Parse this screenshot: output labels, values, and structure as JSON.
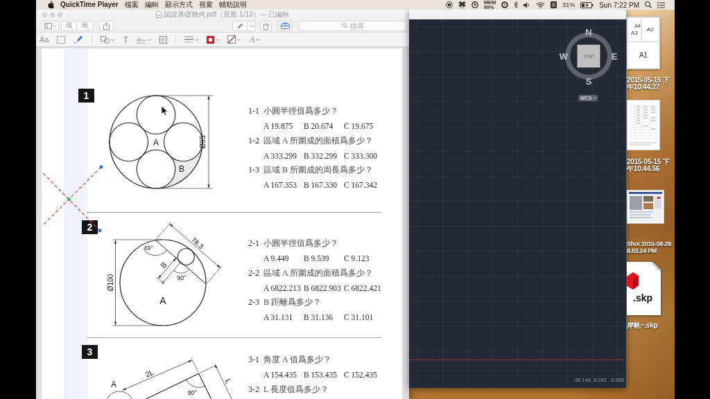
{
  "menu_bar": {
    "app_name": "QuickTime Player",
    "menus": [
      "檔案",
      "編輯",
      "顯示方式",
      "視窗",
      "輔助說明"
    ],
    "memory_label": "MEM",
    "memory_value": "99%",
    "battery_percent": "31%",
    "battery_charging": true,
    "clock": "Sun 7:22 PM"
  },
  "pdf_window": {
    "title": "認證基礎幾何.pdf（頁面 1/13）— 已編輯",
    "toolbar_left": [
      {
        "kind": "sidebar",
        "has_menu": true
      },
      {
        "kind": "zoom-out"
      },
      {
        "kind": "zoom-in"
      },
      {
        "kind": "share"
      }
    ],
    "toolbar_right": [
      {
        "kind": "highlight",
        "has_menu": true
      },
      {
        "kind": "rotate"
      },
      {
        "kind": "toolbox",
        "on": true
      }
    ],
    "search_placeholder": "搜尋",
    "markup_tool_groups": [
      [
        {
          "kind": "text-style",
          "label": "Aa",
          "selected": false
        },
        {
          "kind": "rect-select",
          "selected": false
        },
        {
          "kind": "sketch",
          "selected": true
        }
      ],
      [
        {
          "kind": "shapes",
          "has_menu": true,
          "selected": false
        },
        {
          "kind": "text",
          "label": "T",
          "selected": false
        },
        {
          "kind": "sign",
          "has_menu": true,
          "selected": false
        },
        {
          "kind": "note",
          "selected": false
        }
      ],
      [
        {
          "kind": "line-style",
          "has_menu": true,
          "selected": false
        },
        {
          "kind": "border-color",
          "color": "#b3262d",
          "has_menu": true,
          "selected": false
        },
        {
          "kind": "fill-color",
          "has_menu": true,
          "selected": false
        },
        {
          "kind": "font",
          "label": "A",
          "has_menu": true,
          "selected": false
        }
      ]
    ],
    "page": {
      "annotation": {
        "kind": "dashed-cross",
        "selected": true
      },
      "problems": [
        {
          "number": "1",
          "diagram": {
            "kind": "circles-in-circle",
            "labels": [
              "A",
              "B",
              "Ø95"
            ]
          },
          "questions": [
            {
              "number": "1-1",
              "text": "小圓半徑值爲多少？",
              "options": [
                "A 19.875",
                "B 20.674",
                "C 19.675"
              ]
            },
            {
              "number": "1-2",
              "text": "區域 A 所圍成的面積爲多少？",
              "options": [
                "A 333.299",
                "B 332.299",
                "C 333.300"
              ]
            },
            {
              "number": "1-3",
              "text": "區域 B 所圍成的周長爲多少？",
              "options": [
                "A 167.353",
                "B 167.330",
                "C 167.342"
              ]
            }
          ]
        },
        {
          "number": "2",
          "diagram": {
            "kind": "circle-with-chord",
            "labels": [
              "78.3",
              "49°",
              "B",
              "90°",
              "Ø100",
              "A"
            ]
          },
          "questions": [
            {
              "number": "2-1",
              "text": "小圓半徑值爲多少？",
              "options": [
                "A 9.449",
                "B 9.539",
                "C 9.123"
              ]
            },
            {
              "number": "2-2",
              "text": "區域 A 所圍成的面積爲多少？",
              "options": [
                "A 6822.213",
                "B 6822.903",
                "C 6822.421"
              ]
            },
            {
              "number": "2-3",
              "text": "B 距離爲多少？",
              "options": [
                "A 31.131",
                "B 31.136",
                "C 31.101"
              ]
            }
          ]
        },
        {
          "number": "3",
          "diagram": {
            "kind": "slanted-rectangle",
            "labels": [
              "A",
              "2L",
              "L",
              "90°"
            ]
          },
          "questions": [
            {
              "number": "3-1",
              "text": "角度 A 值爲多少？",
              "options": [
                "A 154.435",
                "B 153.435",
                "C 152.435"
              ]
            },
            {
              "number": "3-2",
              "text": "L 長度值爲多少？"
            }
          ]
        }
      ]
    }
  },
  "cad_window": {
    "view_cube": {
      "north": "N",
      "east": "E",
      "south": "S",
      "west": "W",
      "face": "TOP"
    },
    "coordinate_system": "WCS",
    "coordinates": "-35.140, 8.242 , 0.000"
  },
  "desktop_icons": [
    {
      "kind": "layout-screenshot",
      "thumbnail_texts": [
        "A4",
        "A3",
        "A2",
        "A1"
      ],
      "label": "2015-05-15 下午10.44.27"
    },
    {
      "kind": "table-screenshot",
      "label": "2015-05-15 下午10.44.56"
    },
    {
      "kind": "webpage-screenshot",
      "label": "Shot 2015-08-29 8.53.24 PM"
    },
    {
      "kind": "skp-file",
      "file_extension": ".skp",
      "label": "岸帆~.skp"
    }
  ]
}
